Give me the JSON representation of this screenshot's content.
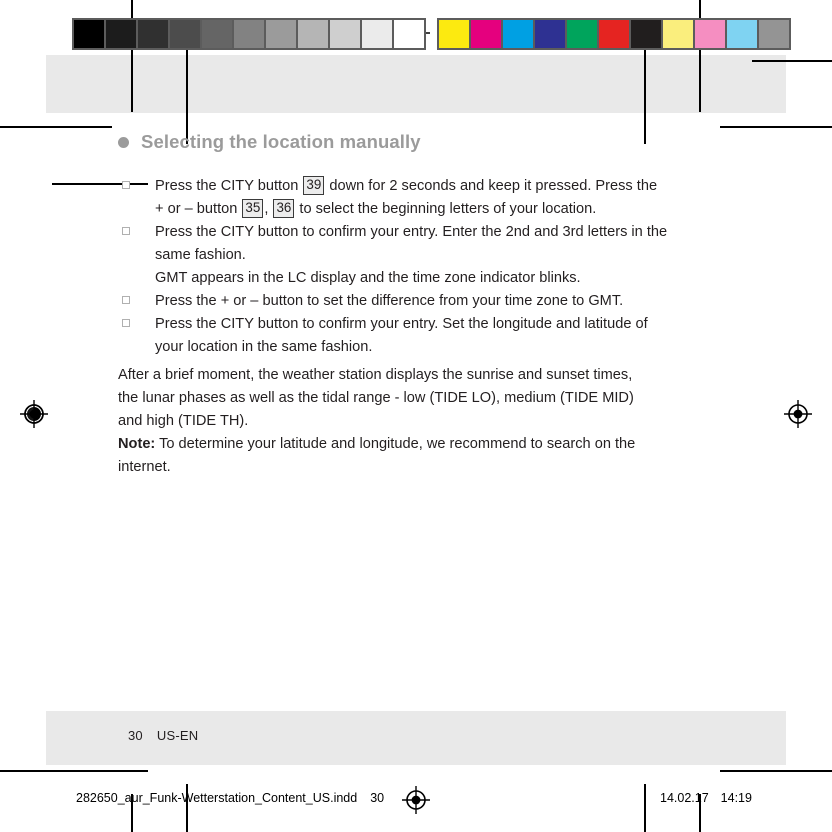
{
  "document": {
    "heading": "Selecting the location manually",
    "heading_bullet_icon": "filled-circle-icon",
    "steps": [
      {
        "marker_icon": "square-bullet-icon",
        "lines": [
          [
            {
              "t": "text",
              "v": "Press the CITY button "
            },
            {
              "t": "ref",
              "v": "39"
            },
            {
              "t": "text",
              "v": " down for 2 seconds and keep it pressed. Press the"
            }
          ],
          [
            {
              "t": "text",
              "v": "+ or – button "
            },
            {
              "t": "ref",
              "v": "35"
            },
            {
              "t": "text",
              "v": ", "
            },
            {
              "t": "ref",
              "v": "36"
            },
            {
              "t": "text",
              "v": " to select the beginning letters of your location."
            }
          ]
        ]
      },
      {
        "marker_icon": "square-bullet-icon",
        "lines": [
          [
            {
              "t": "text",
              "v": "Press the CITY button to confirm your entry. Enter the 2nd and 3rd letters in the"
            }
          ],
          [
            {
              "t": "text",
              "v": "same fashion."
            }
          ],
          [
            {
              "t": "text",
              "v": "GMT appears in the LC display and the time zone indicator blinks."
            }
          ]
        ]
      },
      {
        "marker_icon": "square-bullet-icon",
        "lines": [
          [
            {
              "t": "text",
              "v": "Press the + or – button to set the difference from your time zone to GMT."
            }
          ]
        ]
      },
      {
        "marker_icon": "square-bullet-icon",
        "lines": [
          [
            {
              "t": "text",
              "v": "Press the CITY button to confirm your entry. Set the longitude and latitude of"
            }
          ],
          [
            {
              "t": "text",
              "v": "your location in the same fashion."
            }
          ]
        ]
      }
    ],
    "paragraph": [
      "After a brief moment, the weather station displays the sunrise and sunset times,",
      "the lunar phases as well as the tidal range - low (TIDE LO), medium (TIDE MID)",
      "and high (TIDE TH)."
    ],
    "note": {
      "label": "Note:",
      "lines": [
        " To determine your latitude and longitude, we recommend to search on the",
        "internet."
      ]
    }
  },
  "footer": {
    "page_number": "30",
    "language_code": "US-EN"
  },
  "imprint": {
    "filename": "282650_aur_Funk-Wetterstation_Content_US.indd",
    "page_number": "30",
    "registration_icon": "registration-target-icon",
    "date": "14.02.17",
    "time": "14:19"
  },
  "calibration": {
    "grayscale_label": "grayscale-calibration-bar",
    "grayscale_swatches": [
      "#000000",
      "#1c1c1c",
      "#303030",
      "#4c4c4c",
      "#656565",
      "#828282",
      "#9b9b9b",
      "#b5b5b5",
      "#cfcfcf",
      "#ebebeb",
      "#ffffff"
    ],
    "color_label": "color-calibration-bar",
    "color_swatches": [
      "#fcea10",
      "#e5007e",
      "#00a0e3",
      "#2e3192",
      "#00a45c",
      "#e52421",
      "#211e1e",
      "#faee7d",
      "#f58ec1",
      "#7fd3f2",
      "#949494"
    ],
    "bar_frame_color": "#5c5c5c"
  },
  "proof_marks": {
    "registration_icon": "registration-target-icon",
    "crop_mark": "crop-mark"
  }
}
